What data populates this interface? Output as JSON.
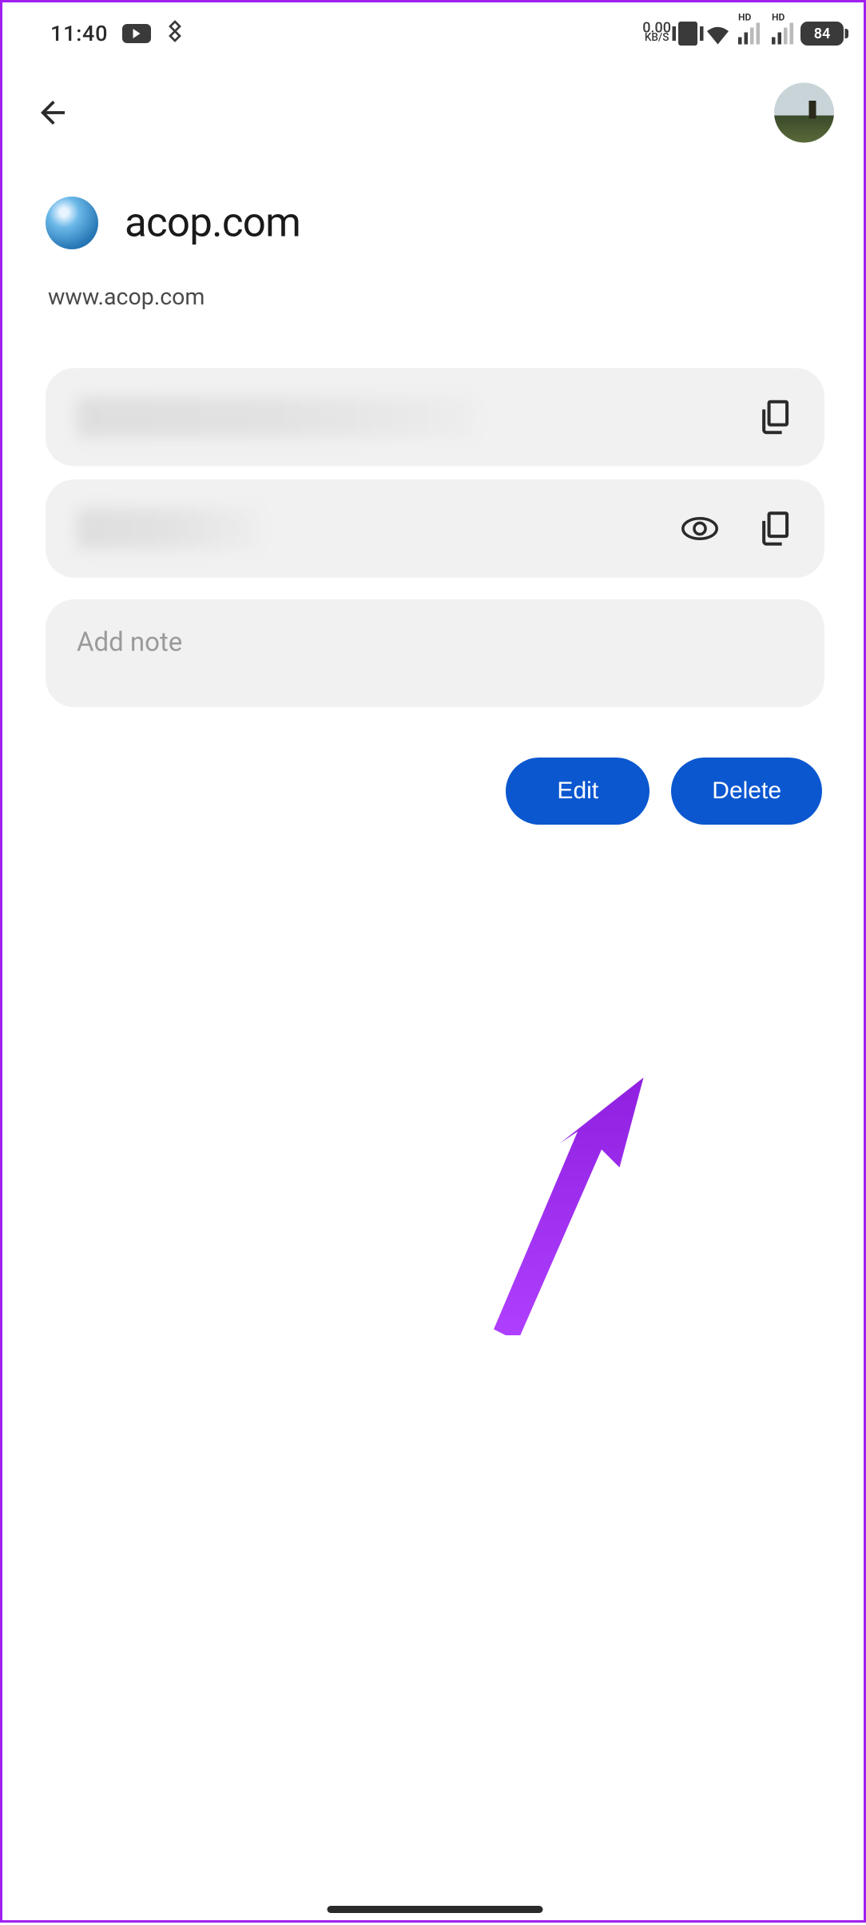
{
  "status": {
    "time": "11:40",
    "data_rate_value": "0.00",
    "data_rate_unit": "KB/S",
    "hd1": "HD",
    "hd2": "HD",
    "battery": "84"
  },
  "site": {
    "name": "acop.com",
    "url": "www.acop.com"
  },
  "note": {
    "placeholder": "Add note"
  },
  "buttons": {
    "edit": "Edit",
    "delete": "Delete"
  }
}
